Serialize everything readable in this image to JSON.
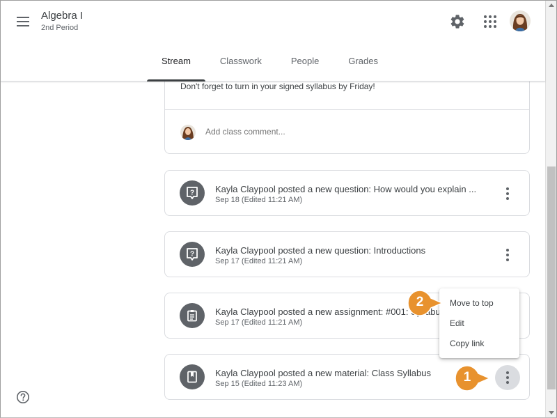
{
  "header": {
    "class_name": "Algebra I",
    "class_section": "2nd Period",
    "tabs": [
      {
        "label": "Stream",
        "active": true
      },
      {
        "label": "Classwork",
        "active": false
      },
      {
        "label": "People",
        "active": false
      },
      {
        "label": "Grades",
        "active": false
      }
    ],
    "icons": [
      "menu-icon",
      "gear-icon",
      "apps-grid-icon",
      "user-avatar"
    ]
  },
  "announcement": {
    "text": "Don't forget to turn in your signed syllabus by Friday!",
    "comment_placeholder": "Add class comment..."
  },
  "posts": [
    {
      "icon": "question-icon",
      "title": "Kayla Claypool posted a new question: How would you explain ...",
      "date": "Sep 18 (Edited 11:21 AM)"
    },
    {
      "icon": "question-icon",
      "title": "Kayla Claypool posted a new question: Introductions",
      "date": "Sep 17 (Edited 11:21 AM)"
    },
    {
      "icon": "assignment-icon",
      "title": "Kayla Claypool posted a new assignment: #001: Syllabus",
      "date": "Sep 17 (Edited 11:21 AM)"
    },
    {
      "icon": "material-icon",
      "title": "Kayla Claypool posted a new material: Class Syllabus",
      "date": "Sep 15 (Edited 11:23 AM)"
    }
  ],
  "context_menu": {
    "items": [
      "Move to top",
      "Edit",
      "Copy link"
    ]
  },
  "callouts": [
    "1",
    "2"
  ],
  "colors": {
    "callout_orange": "#e8922e",
    "icon_gray": "#5f6368",
    "border": "#dadce0"
  }
}
